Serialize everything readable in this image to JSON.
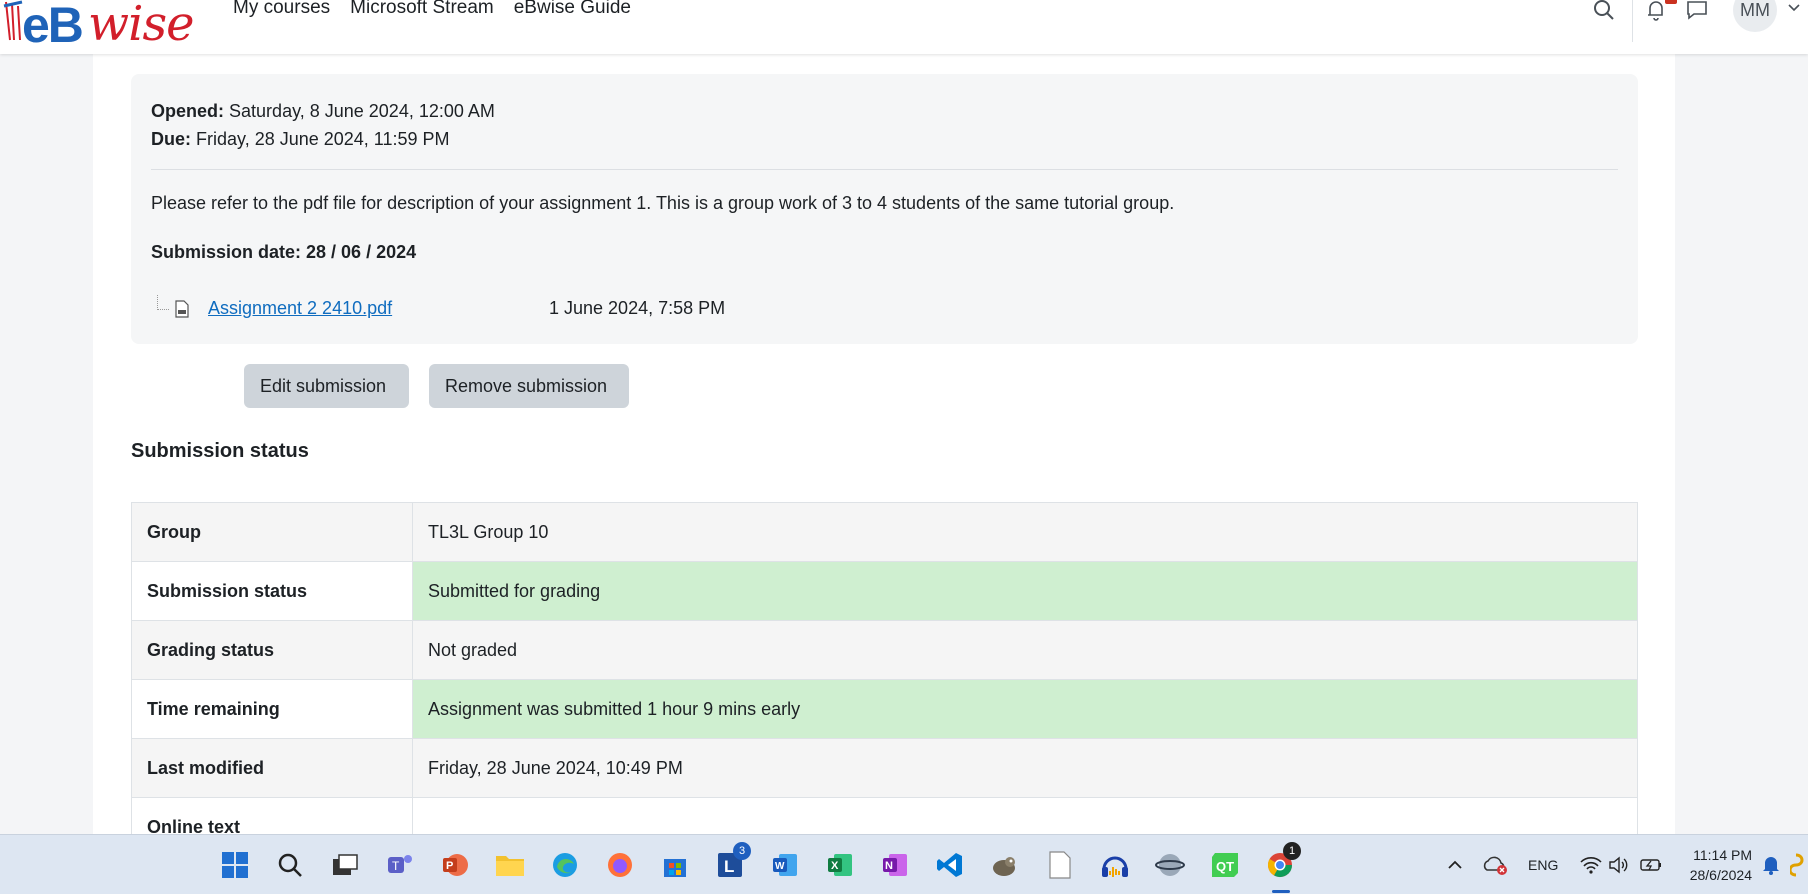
{
  "brand": {
    "logo_eb": "eB",
    "logo_wise": "wise"
  },
  "nav": {
    "links": [
      "My courses",
      "Microsoft Stream",
      "eBwise Guide"
    ],
    "avatar_initials": "MM"
  },
  "assignment": {
    "opened_label": "Opened:",
    "opened_value": "Saturday, 8 June 2024, 12:00 AM",
    "due_label": "Due:",
    "due_value": "Friday, 28 June 2024, 11:59 PM",
    "description": "Please refer to the pdf file for description of your assignment 1. This is a group work of 3 to 4 students of the same tutorial group.",
    "submission_date": "Submission date: 28 / 06 / 2024",
    "file": {
      "name": "Assignment 2 2410.pdf",
      "date": "1 June 2024, 7:58 PM"
    }
  },
  "actions": {
    "edit": "Edit submission",
    "remove": "Remove submission"
  },
  "status": {
    "heading": "Submission status",
    "rows": [
      {
        "label": "Group",
        "value": "TL3L Group 10",
        "highlight": false
      },
      {
        "label": "Submission status",
        "value": "Submitted for grading",
        "highlight": true
      },
      {
        "label": "Grading status",
        "value": "Not graded",
        "highlight": false
      },
      {
        "label": "Time remaining",
        "value": "Assignment was submitted 1 hour 9 mins early",
        "highlight": true
      },
      {
        "label": "Last modified",
        "value": "Friday, 28 June 2024, 10:49 PM",
        "highlight": false
      },
      {
        "label": "Online text",
        "value": "",
        "highlight": false
      }
    ]
  },
  "taskbar": {
    "language": "ENG",
    "time": "11:14 PM",
    "date": "28/6/2024",
    "teams_badge": "3",
    "chrome_badge": "1"
  },
  "colors": {
    "link": "#0f6cbf",
    "success_bg": "#cfefd0",
    "brand_blue": "#1f63b8",
    "brand_red": "#d21f2b"
  }
}
